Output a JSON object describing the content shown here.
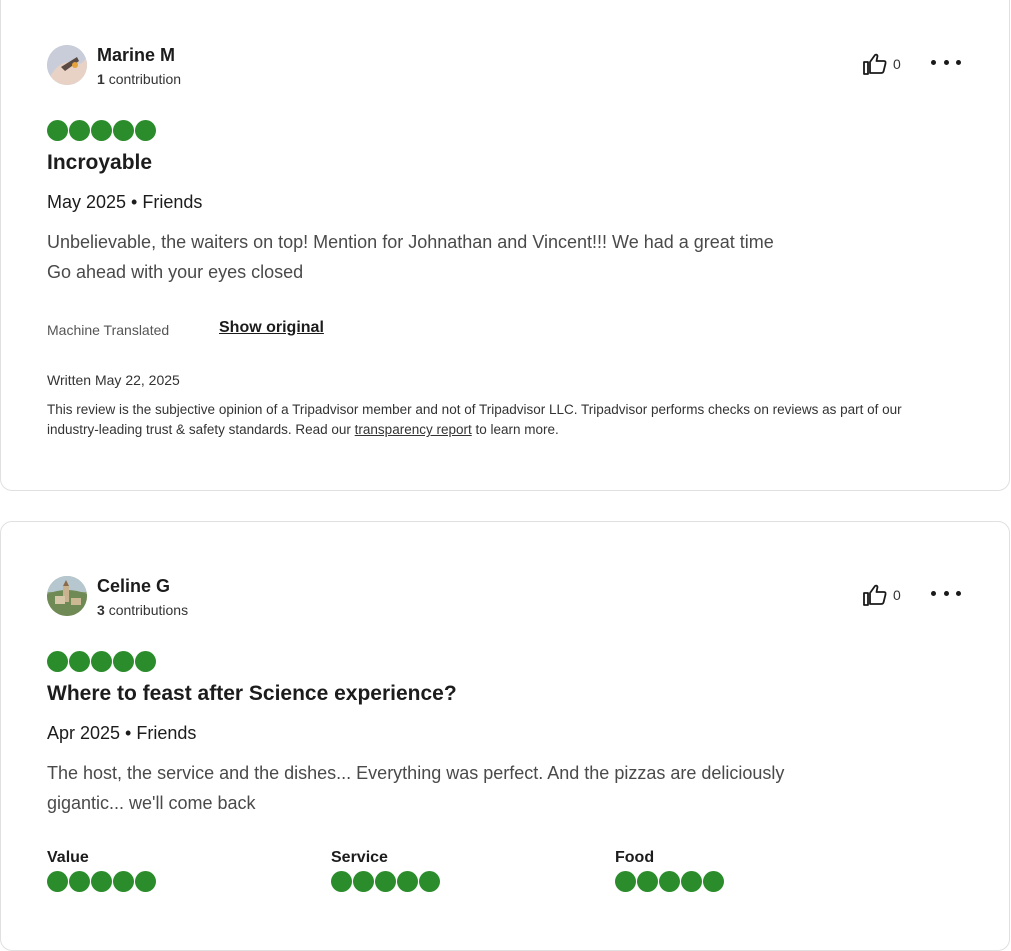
{
  "reviews": [
    {
      "author": "Marine M",
      "contrib_count": "1",
      "contrib_label": "contribution",
      "helpful_count": "0",
      "rating": 5,
      "title": "Incroyable",
      "meta": "May 2025 • Friends",
      "body_lines": [
        "Unbelievable, the waiters on top! Mention for Johnathan and Vincent!!! We had a great time",
        "Go ahead with your eyes closed"
      ],
      "machine_translated": "Machine Translated",
      "show_original": "Show original",
      "written": "Written May 22, 2025",
      "disclaimer_before": "This review is the subjective opinion of a Tripadvisor member and not of Tripadvisor LLC. Tripadvisor performs checks on reviews as part of our industry-leading trust & safety standards. Read our ",
      "disclaimer_link": "transparency report",
      "disclaimer_after": " to learn more."
    },
    {
      "author": "Celine G",
      "contrib_count": "3",
      "contrib_label": "contributions",
      "helpful_count": "0",
      "rating": 5,
      "title": "Where to feast after Science experience?",
      "meta": "Apr 2025 • Friends",
      "body_lines": [
        "The host, the service and the dishes... Everything was perfect. And the pizzas are deliciously",
        "gigantic... we'll come back"
      ],
      "sub_ratings": [
        {
          "label": "Value",
          "rating": 5
        },
        {
          "label": "Service",
          "rating": 5
        },
        {
          "label": "Food",
          "rating": 5
        }
      ]
    }
  ],
  "colors": {
    "bubble": "#2b8c2b",
    "text": "#1c1c1c"
  }
}
